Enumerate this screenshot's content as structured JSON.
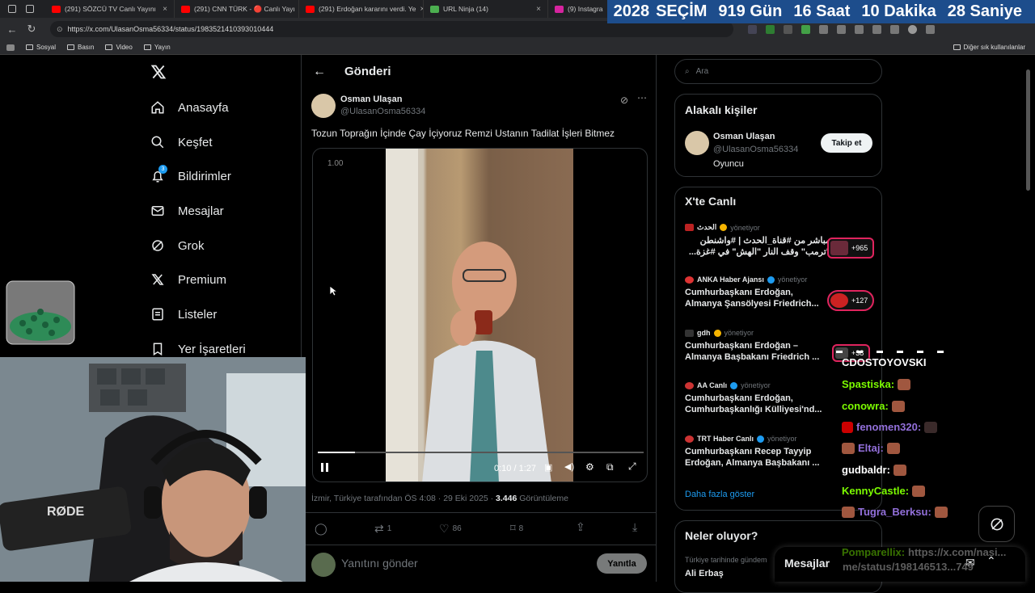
{
  "browser": {
    "tabs": [
      {
        "label": "(291) SÖZCÜ TV Canlı Yayını",
        "color": "#ff0000"
      },
      {
        "label": "(291) CNN TÜRK - 🔴 Canlı Yayı",
        "color": "#ff0000"
      },
      {
        "label": "(291) Erdoğan kararını verdi. Ye",
        "color": "#ff0000"
      },
      {
        "label": "URL Ninja (14)",
        "color": "#4caf50"
      },
      {
        "label": "(9) Instagra",
        "color": "#d6249f"
      }
    ],
    "url": "https://x.com/UlasanOsma56334/status/1983521410393010444",
    "bookmarks": [
      "Sosyal",
      "Basın",
      "Video",
      "Yayın"
    ],
    "bookmarks_right": "Diğer sık kullanılanlar"
  },
  "countdown": {
    "year": "2028",
    "label": "SEÇİM",
    "days": "919 Gün",
    "hours": "16 Saat",
    "minutes": "10 Dakika",
    "seconds": "28 Saniye"
  },
  "nav": {
    "items": [
      {
        "label": "Anasayfa",
        "icon": "home-icon"
      },
      {
        "label": "Keşfet",
        "icon": "search-icon"
      },
      {
        "label": "Bildirimler",
        "icon": "bell-icon",
        "badge": "3"
      },
      {
        "label": "Mesajlar",
        "icon": "envelope-icon"
      },
      {
        "label": "Grok",
        "icon": "grok-icon"
      },
      {
        "label": "Premium",
        "icon": "x-logo-icon"
      },
      {
        "label": "Listeler",
        "icon": "list-icon"
      },
      {
        "label": "Yer İşaretleri",
        "icon": "bookmark-icon"
      }
    ]
  },
  "post": {
    "header_title": "Gönderi",
    "author_name": "Osman Ulaşan",
    "author_handle": "@UlasanOsma56334",
    "text": "Tozun Toprağın İçinde Çay İçiyoruz Remzi Ustanın Tadilat İşleri Bitmez",
    "video": {
      "speed": "1.00",
      "time": "0:10 / 1:27",
      "progress": 0.115
    },
    "meta_location_time": "İzmir, Türkiye tarafından ÖS 4:08 · 29 Eki 2025 ·",
    "views_count": "3.446",
    "views_label": "Görüntüleme",
    "actions": {
      "replies": "",
      "reposts": "1",
      "likes": "86",
      "bookmarks": "8"
    },
    "reply_placeholder": "Yanıtını gönder",
    "reply_button": "Yanıtla"
  },
  "right": {
    "search_placeholder": "Ara",
    "related_title": "Alakalı kişiler",
    "related_person": {
      "name": "Osman Ulaşan",
      "handle": "@UlasanOsma56334",
      "bio": "Oyuncu",
      "follow_label": "Takip et"
    },
    "live_title": "X'te Canlı",
    "live_items": [
      {
        "source": "الحدث",
        "status": "yönetiyor",
        "title1": "مباشر من #قناة_الحدث | #واشنطن",
        "title2": "\"ترمب\" وقف النار \"الهش\" في #غزة...",
        "badge": "+965",
        "rtl": true
      },
      {
        "source": "ANKA Haber Ajansı",
        "status": "yönetiyor",
        "title1": "Cumhurbaşkanı Erdoğan,",
        "title2": "Almanya Şansölyesi Friedrich...",
        "badge": "+127"
      },
      {
        "source": "gdh",
        "status": "yönetiyor",
        "title1": "Cumhurbaşkanı Erdoğan –",
        "title2": "Almanya Başbakanı Friedrich ...",
        "badge": "+38"
      },
      {
        "source": "AA Canlı",
        "status": "yönetiyor",
        "title1": "Cumhurbaşkanı Erdoğan,",
        "title2": "Cumhurbaşkanlığı Külliyesi'nd..."
      },
      {
        "source": "TRT Haber Canlı",
        "status": "yönetiyor",
        "title1": "Cumhurbaşkanı Recep Tayyip",
        "title2": "Erdoğan, Almanya Başbakanı ..."
      }
    ],
    "show_more": "Daha fazla göster",
    "trending_title": "Neler oluyor?",
    "trending_sub": "Türkiye tarihinde gündem",
    "trending_name": "Ali Erbaş",
    "messages_label": "Mesajlar"
  },
  "chat": [
    {
      "user": "CDOSTOYOVSKI",
      "color": "#ffffff"
    },
    {
      "user": "Spastiska:",
      "color": "#7cfc00"
    },
    {
      "user": "conowra:",
      "color": "#7cfc00"
    },
    {
      "user": "fenomen320:",
      "color": "#9370db"
    },
    {
      "user": "Eltaj:",
      "color": "#9370db"
    },
    {
      "user": "gudbaldr:",
      "color": "#ffffff"
    },
    {
      "user": "KennyCastle:",
      "color": "#7cfc00"
    },
    {
      "user": "Tugra_Berksu:",
      "color": "#9370db"
    },
    {
      "user": "Pomparellix:",
      "color": "#7cfc00"
    }
  ],
  "chat_link": "https://x.com/nasi...",
  "chat_link2": "me/status/198146513...749",
  "colors": {
    "accent": "#1d9bf0",
    "live_badge": "#e0245e",
    "countdown_bg": "#1d4d8c"
  }
}
